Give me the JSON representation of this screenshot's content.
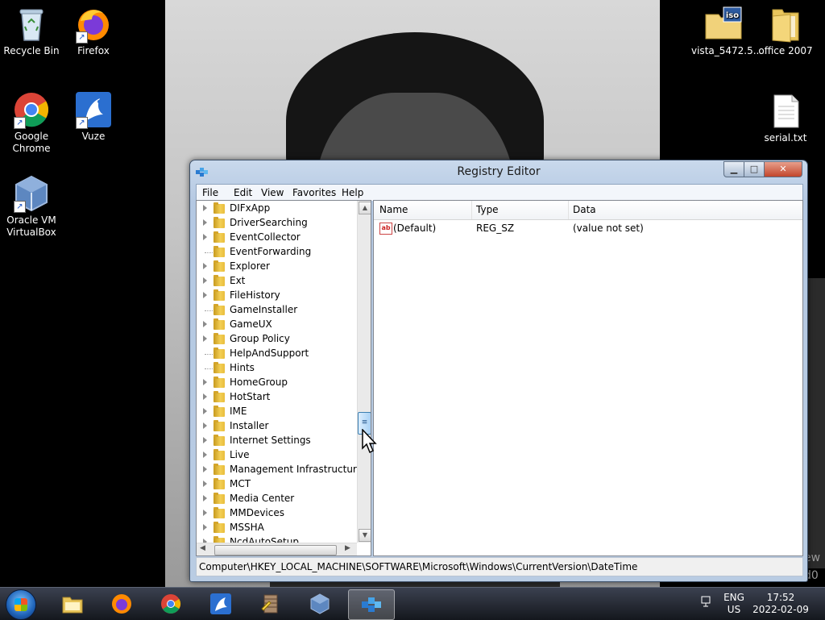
{
  "desktop": {
    "icons": [
      {
        "label": "Recycle Bin"
      },
      {
        "label": "Firefox"
      },
      {
        "label": "Google Chrome"
      },
      {
        "label": "Vuze"
      },
      {
        "label": "Oracle VM VirtualBox"
      },
      {
        "label": "vista_5472.5...."
      },
      {
        "label": "office 2007"
      },
      {
        "label": "serial.txt"
      }
    ],
    "edge_text": [
      "ew",
      "d0"
    ]
  },
  "window": {
    "title": "Registry Editor",
    "menu": [
      "File",
      "Edit",
      "View",
      "Favorites",
      "Help"
    ],
    "tree_items": [
      {
        "label": "DIFxApp",
        "expandable": true
      },
      {
        "label": "DriverSearching",
        "expandable": true
      },
      {
        "label": "EventCollector",
        "expandable": true
      },
      {
        "label": "EventForwarding",
        "expandable": false
      },
      {
        "label": "Explorer",
        "expandable": true
      },
      {
        "label": "Ext",
        "expandable": true
      },
      {
        "label": "FileHistory",
        "expandable": true
      },
      {
        "label": "GameInstaller",
        "expandable": false
      },
      {
        "label": "GameUX",
        "expandable": true
      },
      {
        "label": "Group Policy",
        "expandable": true
      },
      {
        "label": "HelpAndSupport",
        "expandable": false
      },
      {
        "label": "Hints",
        "expandable": false
      },
      {
        "label": "HomeGroup",
        "expandable": true
      },
      {
        "label": "HotStart",
        "expandable": true
      },
      {
        "label": "IME",
        "expandable": true
      },
      {
        "label": "Installer",
        "expandable": true
      },
      {
        "label": "Internet Settings",
        "expandable": true
      },
      {
        "label": "Live",
        "expandable": true
      },
      {
        "label": "Management Infrastructure",
        "expandable": true
      },
      {
        "label": "MCT",
        "expandable": true
      },
      {
        "label": "Media Center",
        "expandable": true
      },
      {
        "label": "MMDevices",
        "expandable": true
      },
      {
        "label": "MSSHA",
        "expandable": true
      },
      {
        "label": "NcdAutoSetup",
        "expandable": true
      }
    ],
    "columns": [
      "Name",
      "Type",
      "Data"
    ],
    "values": [
      {
        "name": "(Default)",
        "type": "REG_SZ",
        "data": "(value not set)",
        "icon_text": "ab"
      }
    ],
    "status_path": "Computer\\HKEY_LOCAL_MACHINE\\SOFTWARE\\Microsoft\\Windows\\CurrentVersion\\DateTime"
  },
  "taskbar": {
    "language": "ENG",
    "region": "US",
    "time": "17:52",
    "date": "2022-02-09"
  }
}
